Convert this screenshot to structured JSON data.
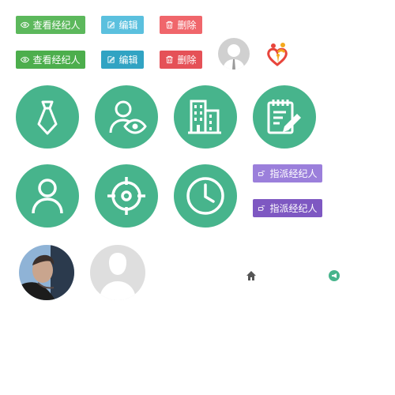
{
  "buttons": {
    "view_label": "查看经纪人",
    "edit_label": "编辑",
    "delete_label": "删除",
    "assign_label": "指派经纪人"
  },
  "icons": {
    "row1": [
      "eye-icon",
      "edit-icon",
      "trash-icon"
    ],
    "circles": [
      "tie-icon",
      "user-view-icon",
      "building-icon",
      "notepad-edit-icon",
      "user-icon",
      "target-icon",
      "clock-icon"
    ],
    "small": [
      "home-icon",
      "megaphone-icon"
    ]
  },
  "colors": {
    "green": "#5cb85c",
    "teal_circle": "#47b48c",
    "blue": "#5bc0de",
    "red": "#f0666b",
    "purple": "#9b7fdb"
  }
}
